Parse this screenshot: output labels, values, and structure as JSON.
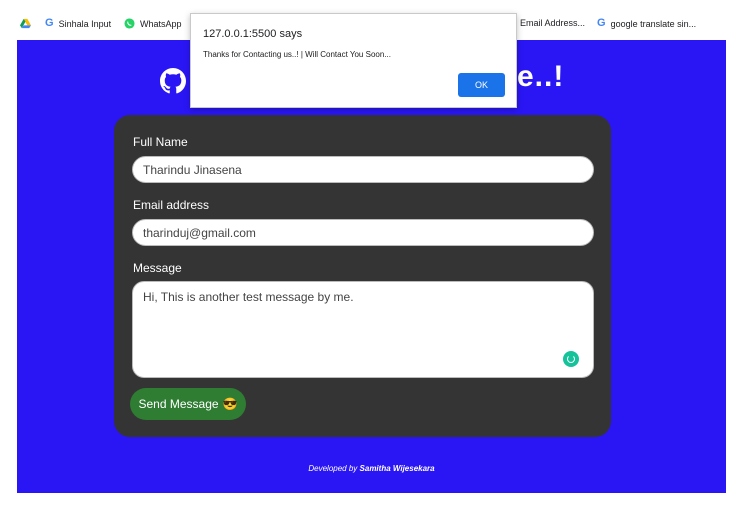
{
  "bookmarks": {
    "sinhala_input": "Sinhala Input",
    "whatsapp": "WhatsApp",
    "email_address": "Email Address...",
    "google_translate": "google translate sin..."
  },
  "page": {
    "heading_tail": "e..!",
    "colors": {
      "background": "#2a16f5",
      "card": "#343434",
      "send_button": "#2e7d32"
    }
  },
  "form": {
    "full_name_label": "Full Name",
    "full_name_value": "Tharindu Jinasena",
    "email_label": "Email address",
    "email_value": "tharinduj@gmail.com",
    "message_label": "Message",
    "message_value": "Hi, This is another test message by me.",
    "send_label": "Send Message",
    "send_emoji": "😎"
  },
  "footer": {
    "prefix": "Developed by",
    "author": "Samitha Wijesekara"
  },
  "dialog": {
    "title": "127.0.0.1:5500 says",
    "message": "Thanks for Contacting us..!  |  Will Contact You Soon...",
    "ok_label": "OK"
  }
}
